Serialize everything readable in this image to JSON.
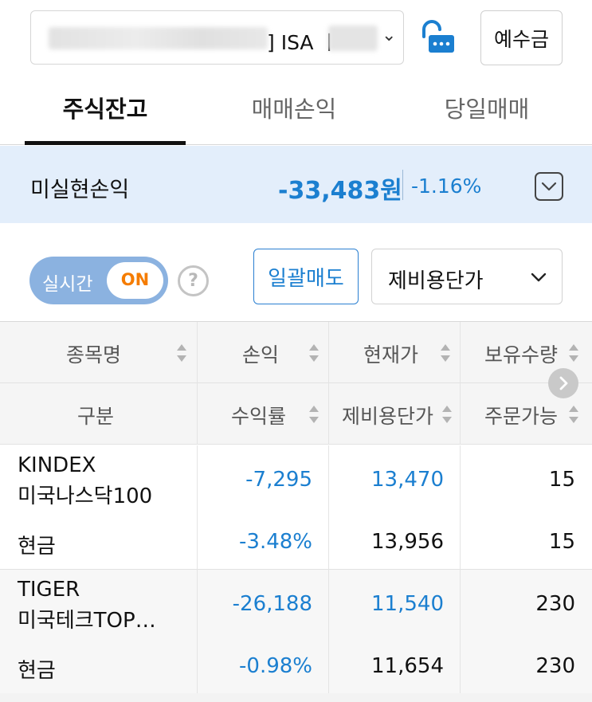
{
  "account": {
    "text": "] ISA ㅣ",
    "chevron": "⌄"
  },
  "icons": {
    "lock": "lock-open-password-icon",
    "help": "question-circle-icon",
    "pnl_toggle": "chevron-down-square-icon",
    "scroll_right": "chevron-right-circle-icon",
    "sort": "sort-updown-icon"
  },
  "header": {
    "deposit_label": "예수금"
  },
  "tabs": [
    {
      "label": "주식잔고",
      "active": true
    },
    {
      "label": "매매손익",
      "active": false
    },
    {
      "label": "당일매매",
      "active": false
    }
  ],
  "pnl": {
    "label": "미실현손익",
    "amount": "-33,483원",
    "rate": "-1.16%"
  },
  "controls": {
    "realtime_label": "실시간",
    "realtime_state": "ON",
    "help_glyph": "?",
    "bulk_sell_label": "일괄매도",
    "cost_basis_label": "제비용단가"
  },
  "table": {
    "header_row1": [
      "종목명",
      "손익",
      "현재가",
      "보유수량"
    ],
    "header_row2": [
      "구분",
      "수익률",
      "제비용단가",
      "주문가능"
    ],
    "rows": [
      {
        "name_line1": "KINDEX",
        "name_line2": "미국나스닥100",
        "type": "현금",
        "profit": "-7,295",
        "profit_rate": "-3.48%",
        "current_price": "13,470",
        "cost_price": "13,956",
        "quantity": "15",
        "orderable": "15"
      },
      {
        "name_line1": "TIGER",
        "name_line2": "미국테크TOP…",
        "type": "현금",
        "profit": "-26,188",
        "profit_rate": "-0.98%",
        "current_price": "11,540",
        "cost_price": "11,654",
        "quantity": "230",
        "orderable": "230"
      }
    ]
  },
  "colors": {
    "accent_blue": "#1b7fd0",
    "banner_bg": "#e3eefb",
    "toggle_bg": "#8bb2e0",
    "toggle_on": "#f57c00"
  }
}
